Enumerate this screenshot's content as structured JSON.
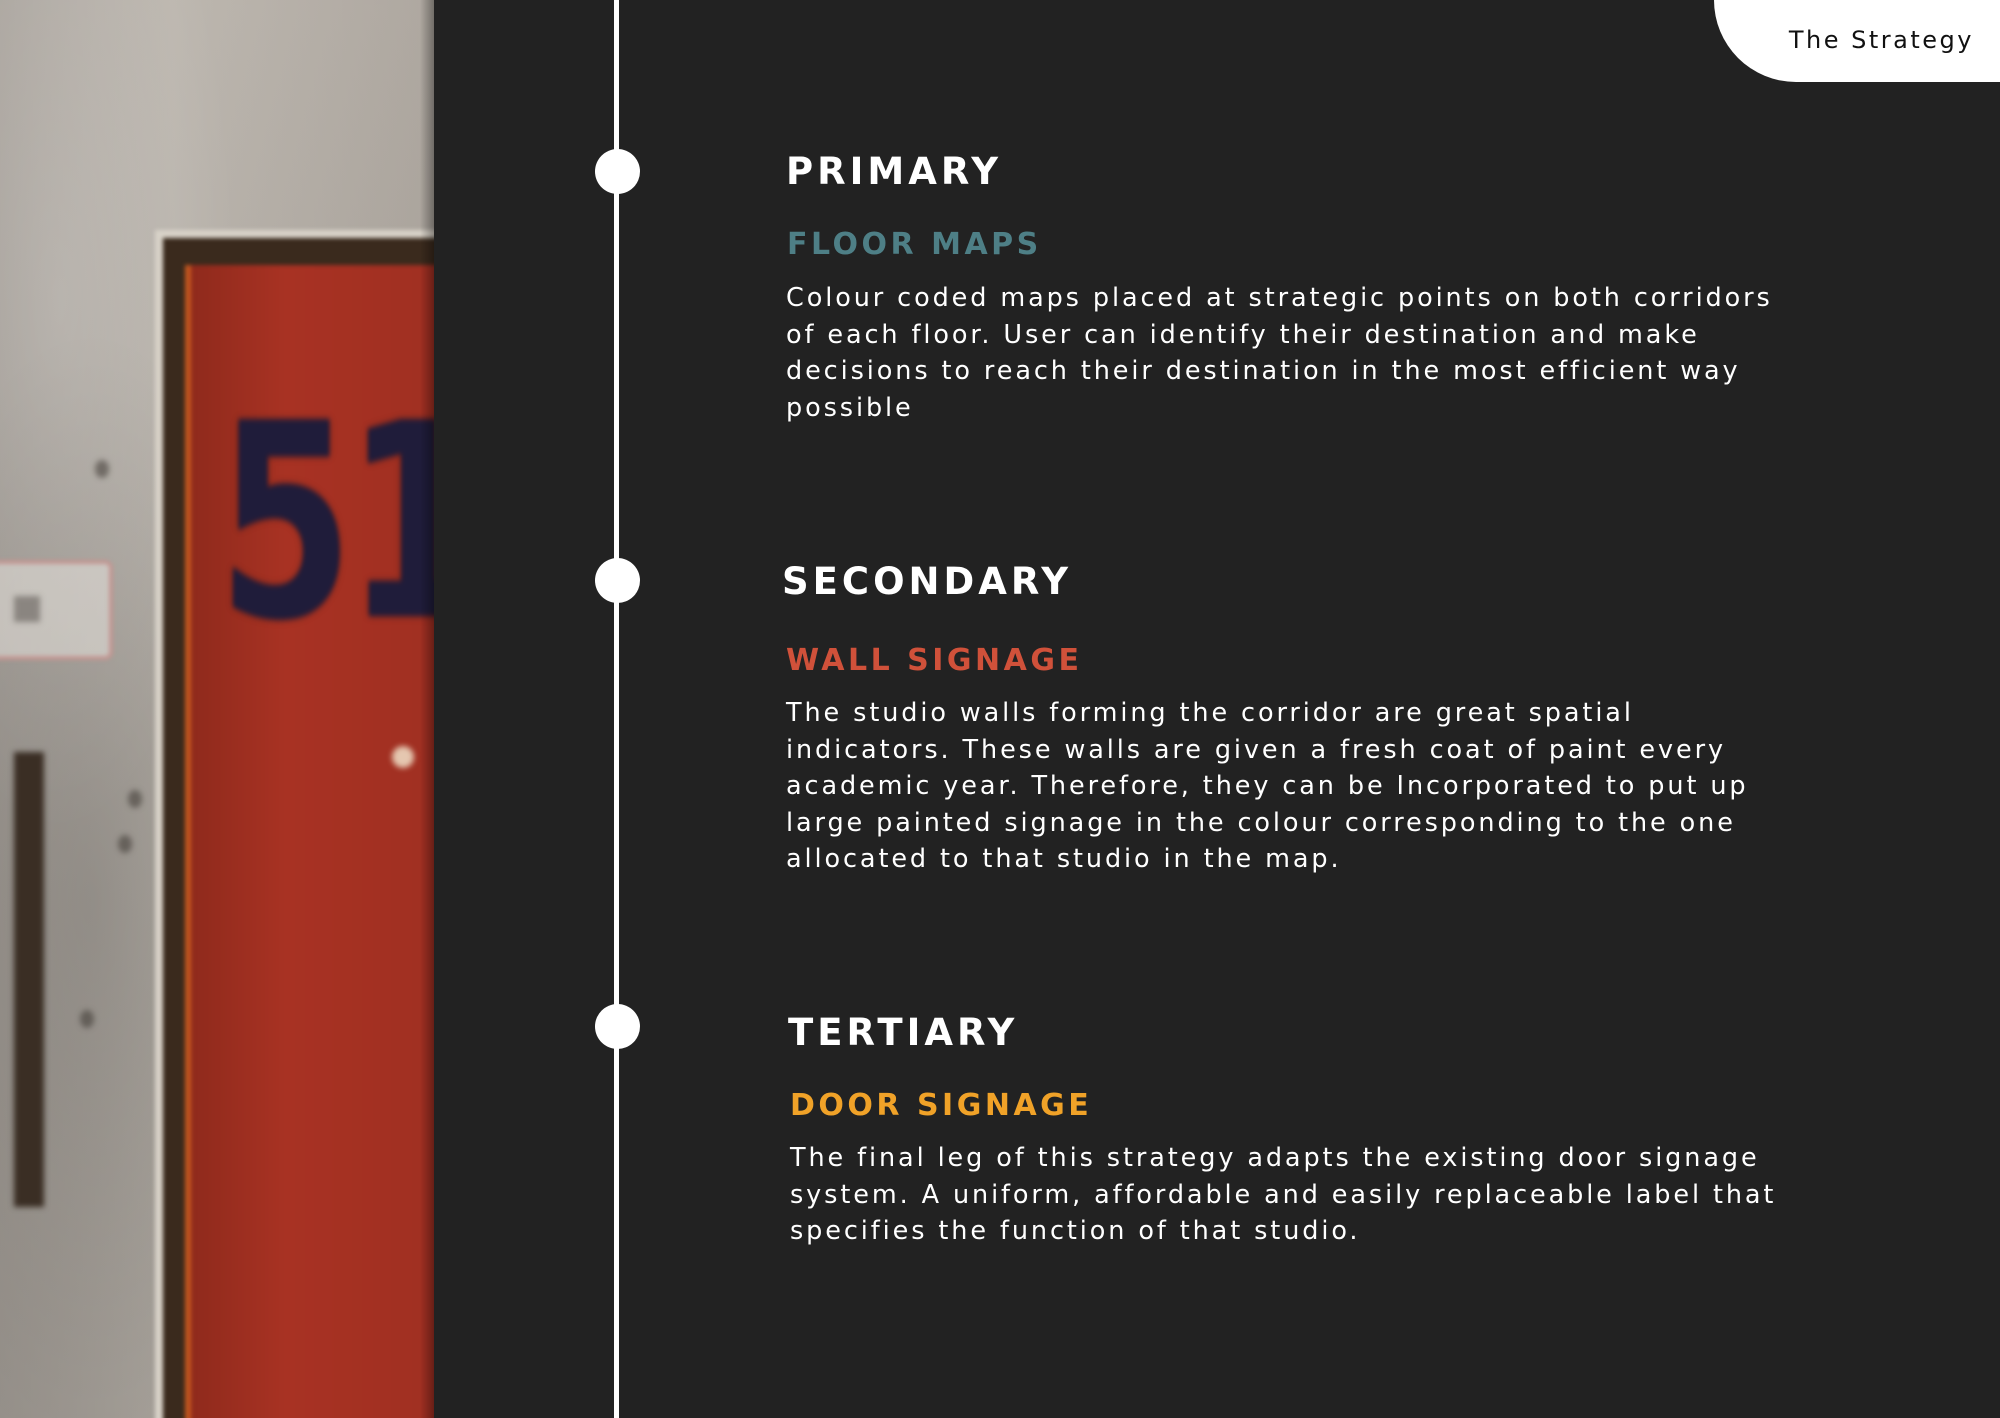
{
  "tab": {
    "label": "The Strategy"
  },
  "photo": {
    "door_number": "51"
  },
  "sections": [
    {
      "tier": "PRIMARY",
      "heading": "FLOOR MAPS",
      "heading_color": "#4e7f86",
      "body": "Colour coded maps placed at strategic points on both corridors of each floor. User can identify their destination and make decisions to reach their destination in the most efficient way possible"
    },
    {
      "tier": "SECONDARY",
      "heading": "WALL SIGNAGE",
      "heading_color": "#d0513a",
      "body": "The studio walls forming the corridor are great spatial indicators. These walls are given a fresh coat of paint every academic year. Therefore, they can be Incorporated to put up large painted signage in the colour corresponding to the one allocated to that studio in the map."
    },
    {
      "tier": "TERTIARY",
      "heading": "DOOR SIGNAGE",
      "heading_color": "#f0a228",
      "body": "The final leg of this strategy adapts the existing door signage system. A uniform, affordable and easily replaceable label that specifies the function of that studio."
    }
  ],
  "colors": {
    "background": "#222222",
    "timeline": "#ffffff",
    "tab_background": "#ffffff"
  }
}
